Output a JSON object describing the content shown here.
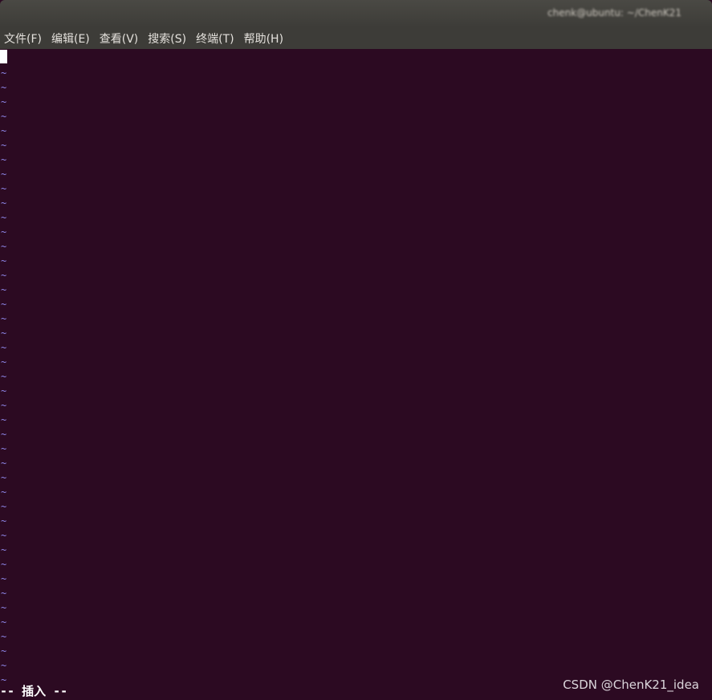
{
  "window": {
    "title": "chenk@ubuntu: ~/ChenK21"
  },
  "menu": {
    "items": [
      {
        "label": "文件(F)"
      },
      {
        "label": "编辑(E)"
      },
      {
        "label": "查看(V)"
      },
      {
        "label": "搜索(S)"
      },
      {
        "label": "终端(T)"
      },
      {
        "label": "帮助(H)"
      }
    ]
  },
  "editor": {
    "tilde_char": "~",
    "tilde_count": 43,
    "mode_line": "-- 插入 --"
  },
  "watermark": {
    "text": "CSDN @ChenK21_idea"
  },
  "colors": {
    "terminal_background": "#2c0a22",
    "tilde": "#8e86e8",
    "menubar": "#3d3c38",
    "cursor": "#ffffff"
  }
}
